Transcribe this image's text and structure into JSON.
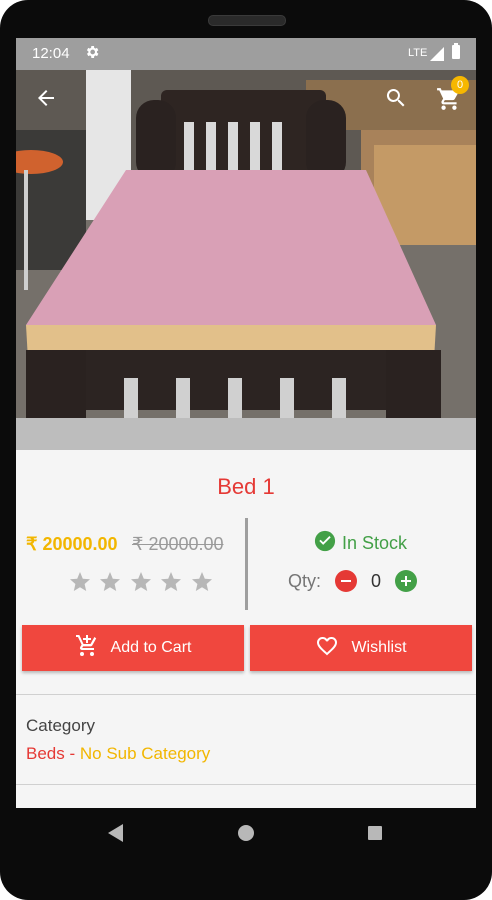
{
  "status_bar": {
    "time": "12:04",
    "network": "LTE"
  },
  "toolbar": {
    "cart_count": "0"
  },
  "product": {
    "title": "Bed 1",
    "price_sale": "₹ 20000.00",
    "price_original": "₹ 20000.00",
    "rating": 0,
    "rating_max": 5,
    "stock_status": "In Stock",
    "qty_label": "Qty:",
    "qty_value": "0"
  },
  "actions": {
    "add_to_cart": "Add to Cart",
    "wishlist": "Wishlist"
  },
  "category": {
    "label": "Category",
    "main": "Beds",
    "separator": " - ",
    "sub": "No Sub Category"
  },
  "colors": {
    "accent_red": "#e53935",
    "button_red": "#f0473e",
    "price_yellow": "#f2b600",
    "stock_green": "#43a047"
  },
  "icons": [
    "back-arrow-icon",
    "search-icon",
    "cart-icon",
    "check-circle-icon",
    "minus-icon",
    "plus-icon",
    "heart-icon",
    "add-cart-icon",
    "star-icon"
  ]
}
